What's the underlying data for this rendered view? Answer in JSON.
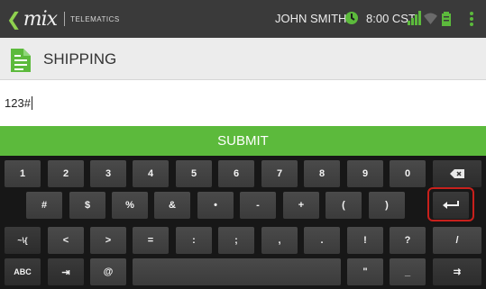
{
  "statusbar": {
    "logo_text": "mix",
    "logo_sub": "TELEMATICS",
    "user": "JOHN SMITH",
    "time": "8:00 CST",
    "icons": [
      "back-arrow-icon",
      "clock-icon",
      "signal-icon",
      "wifi-icon",
      "battery-icon",
      "overflow-menu-icon"
    ]
  },
  "header": {
    "title": "SHIPPING",
    "icon": "document-icon"
  },
  "input": {
    "value": "123#"
  },
  "submit": {
    "label": "SUBMIT"
  },
  "keyboard": {
    "row1": [
      "1",
      "2",
      "3",
      "4",
      "5",
      "6",
      "7",
      "8",
      "9",
      "0",
      "⌫"
    ],
    "row2": [
      "#",
      "$",
      "%",
      "&",
      "•",
      "-",
      "+",
      "(",
      ")",
      "↵"
    ],
    "row3": [
      "~\\{",
      "<",
      ">",
      "=",
      ":",
      ";",
      ",",
      ".",
      "!",
      "?",
      "/"
    ],
    "row4": [
      "ABC",
      "⇥",
      "@",
      "",
      "\"",
      "_",
      "⇉"
    ]
  },
  "colors": {
    "accent_green": "#5cba3c",
    "highlight_red": "#c8201c",
    "statusbar": "#3a3a3a"
  }
}
